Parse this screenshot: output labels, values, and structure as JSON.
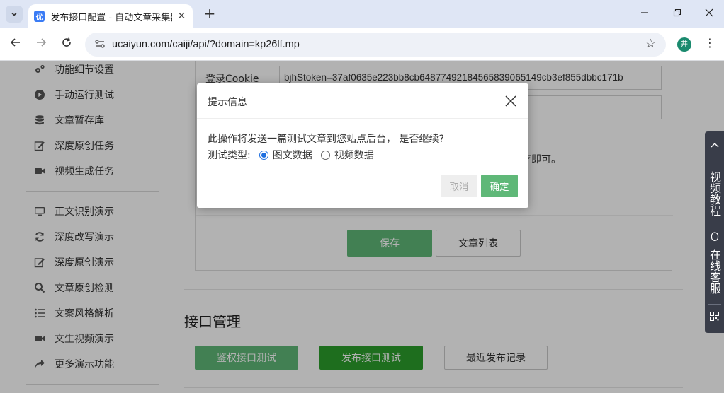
{
  "browser": {
    "tab_title": "发布接口配置 - 自动文章采集器",
    "tab_favicon": "优",
    "tab_close": "✕",
    "new_tab": "+",
    "url": "ucaiyun.com/caiji/api/?domain=kp26lf.mp",
    "profile_initial": "井"
  },
  "sidebar": {
    "group1": [
      {
        "label": "功能细节设置",
        "icon": "gears-icon"
      },
      {
        "label": "手动运行测试",
        "icon": "play-icon"
      },
      {
        "label": "文章暂存库",
        "icon": "database-icon"
      },
      {
        "label": "深度原创任务",
        "icon": "edit-icon"
      },
      {
        "label": "视频生成任务",
        "icon": "video-icon"
      }
    ],
    "group2": [
      {
        "label": "正文识别演示",
        "icon": "monitor-icon"
      },
      {
        "label": "深度改写演示",
        "icon": "refresh-icon"
      },
      {
        "label": "深度原创演示",
        "icon": "edit-icon"
      },
      {
        "label": "文章原创检测",
        "icon": "search-icon"
      },
      {
        "label": "文案风格解析",
        "icon": "list-icon"
      },
      {
        "label": "文生视频演示",
        "icon": "video-icon"
      },
      {
        "label": "更多演示功能",
        "icon": "share-icon"
      }
    ]
  },
  "form": {
    "cookie_label": "登录Cookie",
    "cookie_value": "bjhStoken=37af0635e223bb8cb64877492184565839065149cb3ef855dbbc171b",
    "hint_tail": "存即可。",
    "save_label": "保存",
    "article_list_label": "文章列表"
  },
  "api_section": {
    "title": "接口管理",
    "auth_test_label": "鉴权接口测试",
    "publish_test_label": "发布接口测试",
    "recent_log_label": "最近发布记录"
  },
  "float_panel": {
    "video_tutorial": "视频教程",
    "online_service": "在线客服"
  },
  "modal": {
    "title": "提示信息",
    "message": "此操作将发送一篇测试文章到您站点后台， 是否继续?",
    "type_label": "测试类型:",
    "options": [
      "图文数据",
      "视频数据"
    ],
    "selected": "图文数据",
    "cancel_label": "取消",
    "confirm_label": "确定"
  },
  "colors": {
    "overlay": "rgba(0,0,0,0.3)",
    "confirm_green": "#5fb878",
    "publish_green": "#2c9e2c",
    "radio_blue": "#1e6fe0",
    "float_panel": "#393d49"
  }
}
